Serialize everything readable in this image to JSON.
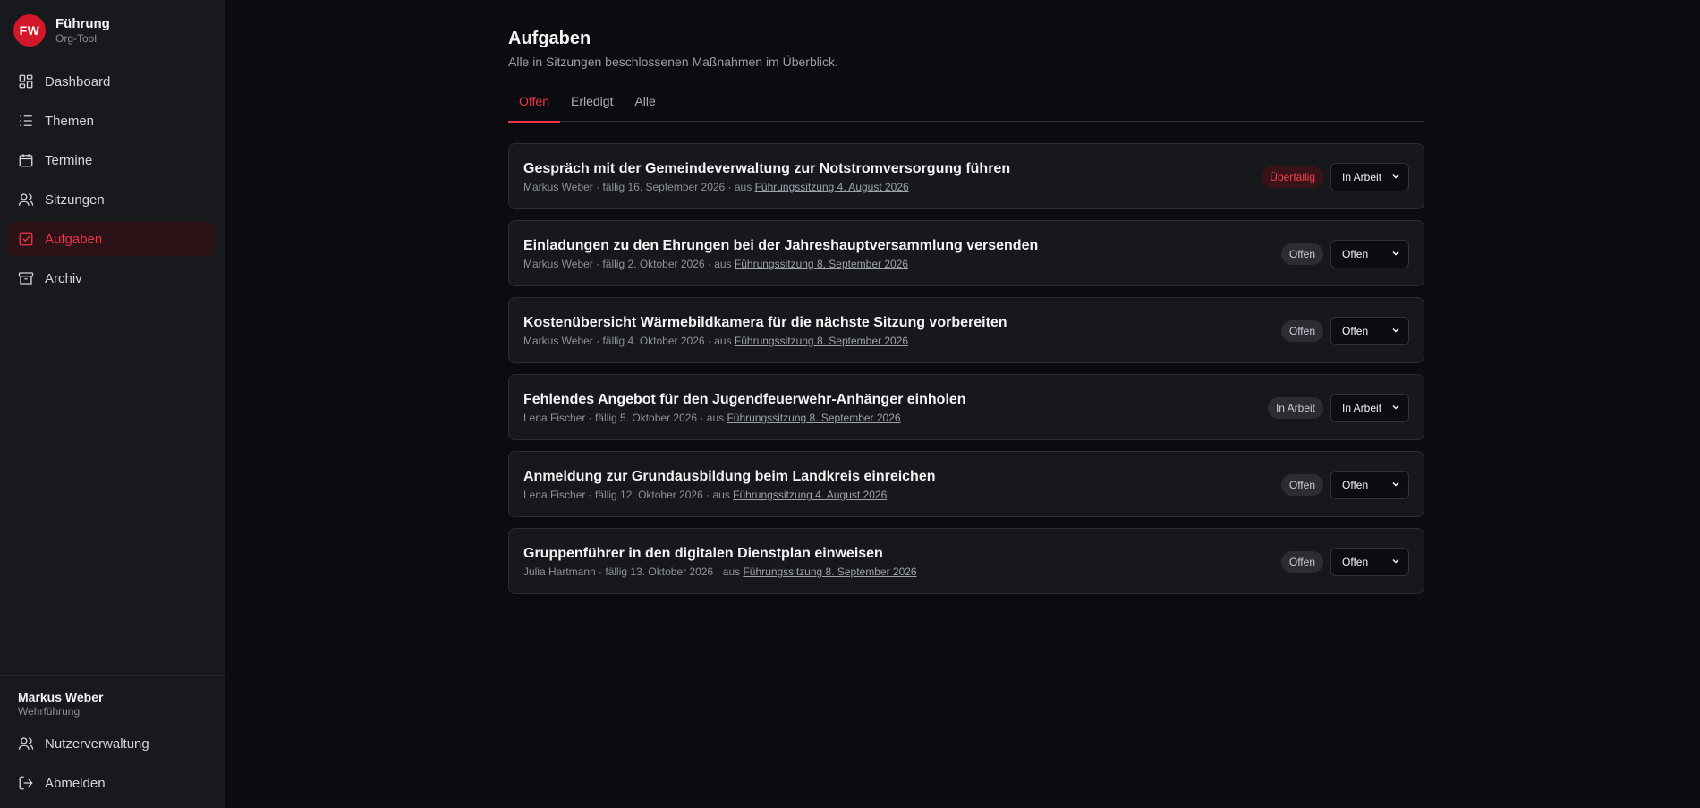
{
  "brand": {
    "logo": "FW",
    "title": "Führung",
    "subtitle": "Org-Tool",
    "color": "#d3172a"
  },
  "nav": [
    {
      "label": "Dashboard",
      "icon": "dashboard-icon"
    },
    {
      "label": "Themen",
      "icon": "list-icon"
    },
    {
      "label": "Termine",
      "icon": "calendar-icon"
    },
    {
      "label": "Sitzungen",
      "icon": "users-icon"
    },
    {
      "label": "Aufgaben",
      "icon": "checkbox-icon",
      "active": true
    },
    {
      "label": "Archiv",
      "icon": "archive-icon"
    }
  ],
  "user": {
    "name": "Markus Weber",
    "role": "Wehrführung"
  },
  "footer_nav": [
    {
      "label": "Nutzerverwaltung",
      "icon": "users-icon"
    },
    {
      "label": "Abmelden",
      "icon": "logout-icon"
    }
  ],
  "page": {
    "title": "Aufgaben",
    "subtitle": "Alle in Sitzungen beschlossenen Maßnahmen im Überblick."
  },
  "tabs": [
    {
      "label": "Offen",
      "active": true
    },
    {
      "label": "Erledigt"
    },
    {
      "label": "Alle"
    }
  ],
  "tasks": [
    {
      "title": "Gespräch mit der Gemeindeverwaltung zur Notstromversorgung führen",
      "meta": "Markus Weber · fällig 16. September 2026 · aus ",
      "session": "Führungssitzung 4. August 2026",
      "badge": "Überfällig",
      "badge_type": "overdue",
      "status": "In Arbeit"
    },
    {
      "title": "Einladungen zu den Ehrungen bei der Jahreshauptversammlung versenden",
      "meta": "Markus Weber · fällig 2. Oktober 2026 · aus ",
      "session": "Führungssitzung 8. September 2026",
      "badge": "Offen",
      "badge_type": "neutral",
      "status": "Offen"
    },
    {
      "title": "Kostenübersicht Wärmebildkamera für die nächste Sitzung vorbereiten",
      "meta": "Markus Weber · fällig 4. Oktober 2026 · aus ",
      "session": "Führungssitzung 8. September 2026",
      "badge": "Offen",
      "badge_type": "neutral",
      "status": "Offen"
    },
    {
      "title": "Fehlendes Angebot für den Jugendfeuerwehr-Anhänger einholen",
      "meta": "Lena Fischer · fällig 5. Oktober 2026 · aus ",
      "session": "Führungssitzung 8. September 2026",
      "badge": "In Arbeit",
      "badge_type": "neutral",
      "status": "In Arbeit"
    },
    {
      "title": "Anmeldung zur Grundausbildung beim Landkreis einreichen",
      "meta": "Lena Fischer · fällig 12. Oktober 2026 · aus ",
      "session": "Führungssitzung 4. August 2026",
      "badge": "Offen",
      "badge_type": "neutral",
      "status": "Offen"
    },
    {
      "title": "Gruppenführer in den digitalen Dienstplan einweisen",
      "meta": "Julia Hartmann · fällig 13. Oktober 2026 · aus ",
      "session": "Führungssitzung 8. September 2026",
      "badge": "Offen",
      "badge_type": "neutral",
      "status": "Offen"
    }
  ]
}
